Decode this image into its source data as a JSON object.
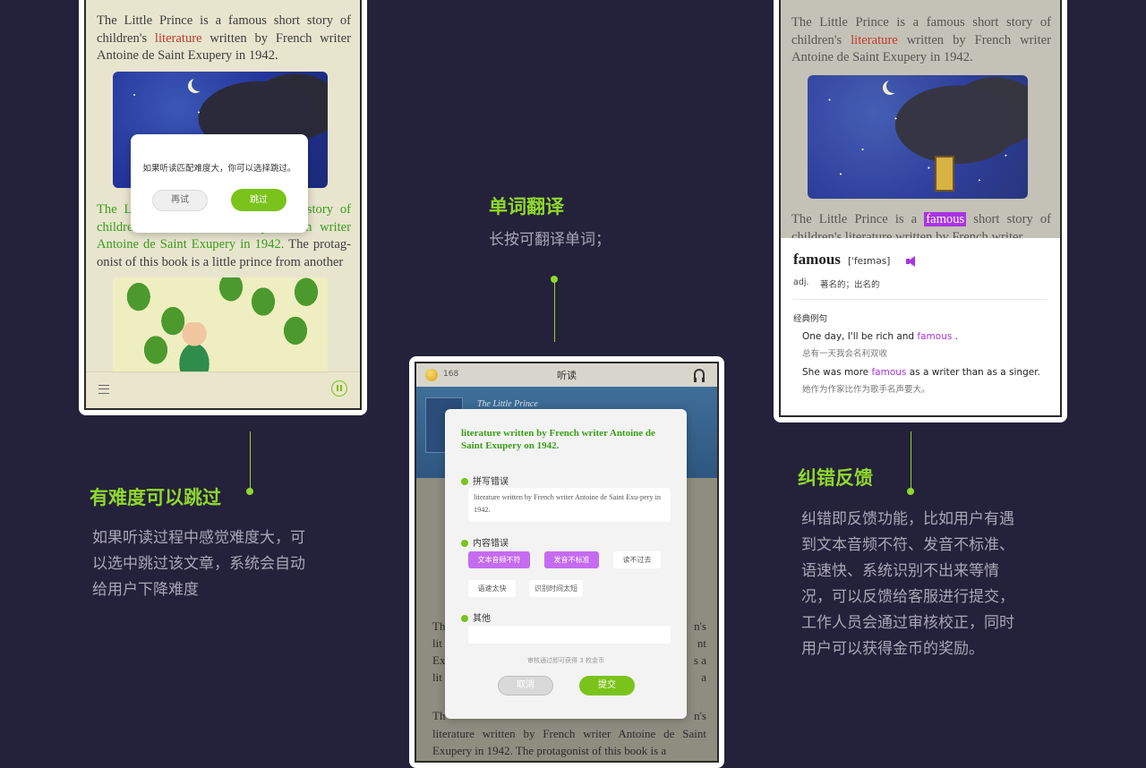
{
  "colors": {
    "accent_green": "#8fd82b",
    "button_green": "#7ac31a",
    "highlight_purple": "#a934e2",
    "background": "#24213a"
  },
  "device1": {
    "para1": {
      "before": "The Little Prince is a famous short story of children's ",
      "highlight": "literature",
      "after": " written by French writer Antoine de Saint Exupery in 1942."
    },
    "para2": {
      "green_part": "The Little Prince is a famous short story of children's literature written by French writer Antoine de Saint Exupery in 1942.",
      "rest": " The protag-onist of this book is a little prince from another"
    },
    "dialog": {
      "message": "如果听读匹配难度大，你可以选择跳过。",
      "retry_label": "再试",
      "skip_label": "跳过"
    }
  },
  "section_skip": {
    "title": "有难度可以跳过",
    "desc_lines": [
      "如果听读过程中感觉难度大，可",
      "以选中跳过该文章，系统会自动",
      "给用户下降难度"
    ]
  },
  "section_translate": {
    "title": "单词翻译",
    "desc": "长按可翻译单词；"
  },
  "section_feedback": {
    "title": "纠错反馈",
    "desc_lines": [
      "纠错即反馈功能，比如用户有遇",
      "到文本音频不符、发音不标准、",
      "语速快、系统识别不出来等情",
      "况，可以反馈给客服进行提交，",
      "工作人员会通过审核校正，同时",
      "用户可以获得金币的奖励。"
    ]
  },
  "device2": {
    "coins": "168",
    "title": "听读",
    "book_title": "The Little Prince",
    "bg_text_lines": [
      "Th",
      "lit",
      "Ex",
      "lit"
    ],
    "bg_text_right": [
      "n's",
      "nt",
      "s a",
      "a"
    ],
    "bottom_text": {
      "before": "Th",
      "after": "n's",
      "rest": "literature written by French writer Antoine de Saint Exupery in 1942. The protagonist of this book is a"
    },
    "dialog": {
      "quote": "literature written by French writer Antoine de Saint Exupery on 1942.",
      "spelling_label": "拼写错误",
      "spelling_value": "literature written by French writer Antoine de Saint Exu-pery in 1942.",
      "content_label": "内容错误",
      "tags": [
        "文本音频不符",
        "发音不标准",
        "读不过去",
        "语速太快",
        "识别时间太短"
      ],
      "other_label": "其他",
      "hint": "审核通过即可获得 3 枚金币",
      "cancel_label": "取消",
      "submit_label": "提交"
    }
  },
  "device3": {
    "para1": {
      "before": "The Little Prince is a famous short story of children's ",
      "highlight": "literature",
      "after": " written by French writer Antoine de Saint Exupery in 1942."
    },
    "para2": {
      "before": "The Little Prince is a ",
      "highlight": "famous",
      "after": " short story of children's literature written by French writer"
    },
    "word": "famous",
    "phonetic": "[ˈfeɪməs]",
    "pos": "adj.",
    "meaning": "著名的；出名的",
    "examples_title": "经典例句",
    "ex1": {
      "before": "One day, I'll be rich and ",
      "hl": "famous",
      "after": " .",
      "cn": "总有一天我会名利双收"
    },
    "ex2": {
      "before": "She was more ",
      "hl": "famous",
      "after": " as a writer than as a singer.",
      "cn": "她作为作家比作为歌手名声要大。"
    }
  }
}
